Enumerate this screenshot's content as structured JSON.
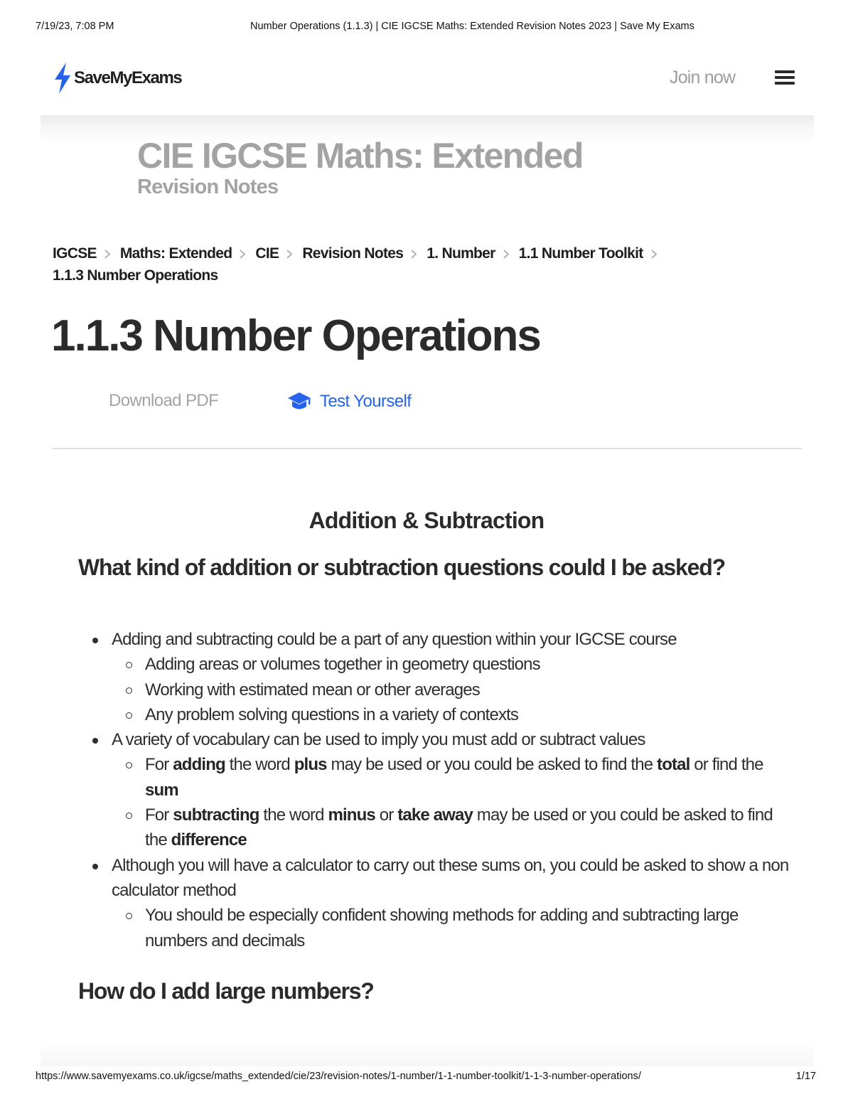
{
  "print_header": {
    "datetime": "7/19/23, 7:08 PM",
    "document_title": "Number Operations (1.1.3) | CIE IGCSE Maths: Extended Revision Notes 2023 | Save My Exams"
  },
  "nav": {
    "logo_icon": "lightning-bolt-icon",
    "logo_text": "SaveMyExams",
    "join_label": "Join now",
    "menu_icon": "hamburger-menu-icon"
  },
  "hero": {
    "title": "CIE IGCSE Maths: Extended",
    "subtitle": "Revision Notes"
  },
  "breadcrumb": {
    "items": [
      "IGCSE",
      "Maths: Extended",
      "CIE",
      "Revision Notes",
      "1. Number",
      "1.1 Number Toolkit",
      "1.1.3 Number Operations"
    ],
    "separator_icon": "chevron-right-icon"
  },
  "page_title": "1.1.3 Number Operations",
  "actions": {
    "download_label": "Download PDF",
    "test_label": "Test Yourself",
    "test_icon": "graduation-cap-icon"
  },
  "colors": {
    "brand_blue": "#2563eb",
    "muted_gray": "#a3a3a3",
    "text_dark": "#2b2b2b"
  },
  "content": {
    "section_heading": "Addition & Subtraction",
    "question_heading": "What kind of addition or subtraction questions could I be asked?",
    "bullets": [
      {
        "text": "Adding and subtracting could be a part of any question within your IGCSE course",
        "sub": [
          "Adding areas or volumes together in geometry questions",
          "Working with estimated mean or other averages",
          "Any problem solving questions in a variety of contexts"
        ]
      },
      {
        "text": "A variety of vocabulary can be used to imply you must add or subtract values",
        "sub_rich": [
          {
            "p1": "For ",
            "b1": "adding",
            "p2": " the word ",
            "b2": "plus",
            "p3": " may be used or you could be asked to find the ",
            "b3": "total",
            "p4": " or find the ",
            "b4": "sum",
            "p5": ""
          },
          {
            "p1": "For ",
            "b1": "subtracting",
            "p2": " the word ",
            "b2": "minus",
            "p3": " or ",
            "b3": "take away",
            "p4": " may be used or you could be asked to find the ",
            "b4": "difference",
            "p5": ""
          }
        ]
      },
      {
        "text": "Although you will have a calculator to carry out these sums on, you could be asked to show a non calculator method",
        "sub": [
          "You should be especially confident showing methods for adding and subtracting large numbers and decimals"
        ]
      }
    ],
    "next_heading": "How do I add large numbers?"
  },
  "print_footer": {
    "url": "https://www.savemyexams.co.uk/igcse/maths_extended/cie/23/revision-notes/1-number/1-1-number-toolkit/1-1-3-number-operations/",
    "page": "1/17"
  }
}
